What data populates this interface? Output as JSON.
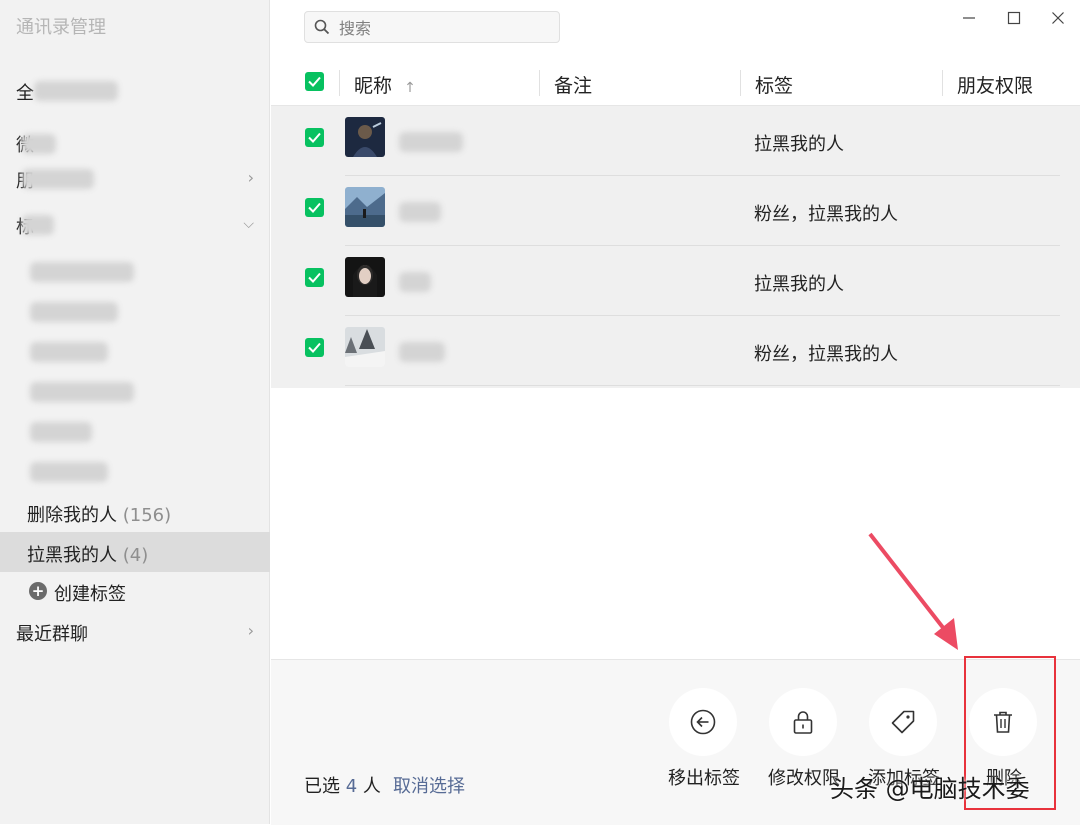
{
  "sidebar": {
    "title": "通讯录管理",
    "groups": [
      {
        "label": "全"
      },
      {
        "label": "微"
      },
      {
        "label": "朋"
      },
      {
        "label": "标"
      }
    ],
    "tags": [
      {
        "label": "删除我的人",
        "count": "(156)"
      },
      {
        "label": "拉黑我的人",
        "count": "(4)"
      }
    ],
    "create_tag": "创建标签",
    "recent_groups": "最近群聊"
  },
  "search": {
    "placeholder": "搜索"
  },
  "table": {
    "columns": [
      "昵称",
      "备注",
      "标签",
      "朋友权限"
    ],
    "sort_indicator": "↑",
    "rows": [
      {
        "tag": "拉黑我的人"
      },
      {
        "tag": "粉丝，拉黑我的人"
      },
      {
        "tag": "拉黑我的人"
      },
      {
        "tag": "粉丝，拉黑我的人"
      }
    ]
  },
  "footer": {
    "selected_prefix": "已选",
    "selected_count": "4",
    "selected_suffix": "人",
    "cancel_selection": "取消选择",
    "actions": [
      {
        "label": "移出标签",
        "icon": "arrow-left-circle-icon"
      },
      {
        "label": "修改权限",
        "icon": "lock-icon"
      },
      {
        "label": "添加标签",
        "icon": "tag-icon"
      },
      {
        "label": "删除",
        "icon": "trash-icon"
      }
    ]
  },
  "watermark": "头条 @电脑技术委",
  "colors": {
    "check": "#07c160",
    "link": "#576b95",
    "highlight": "#e8323c"
  }
}
